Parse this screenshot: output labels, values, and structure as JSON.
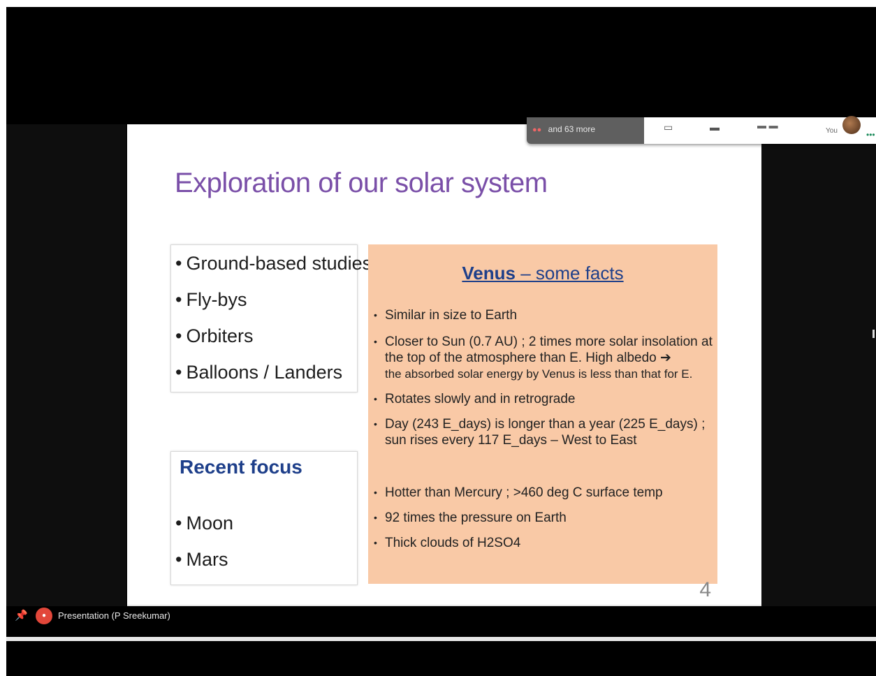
{
  "slide": {
    "title": "Exploration of our solar system",
    "methods": [
      "Ground-based studies",
      "Fly-bys",
      "Orbiters",
      "Balloons / Landers"
    ],
    "recent_focus": {
      "title": "Recent focus",
      "items": [
        "Moon",
        "Mars"
      ]
    },
    "venus": {
      "title_bold": "Venus",
      "title_rest": " – some facts",
      "facts": [
        "Similar in size to Earth",
        "Closer to Sun (0.7 AU) ; 2 times more solar insolation at the top of the atmosphere than E. High albedo ➔",
        "the absorbed solar energy by Venus is less than that for E.",
        "Rotates slowly and in retrograde",
        "Day (243 E_days) is longer than a year (225 E_days) ; sun rises every 117 E_days – West to East",
        "Hotter than Mercury ; >460 deg C surface temp",
        "92 times the pressure on Earth",
        "Thick clouds of H2SO4"
      ]
    },
    "page_number": "4"
  },
  "meeting": {
    "participants_label": "and 63 more",
    "you_label": "You",
    "presenter_label": "Presentation (P Sreekumar)"
  }
}
